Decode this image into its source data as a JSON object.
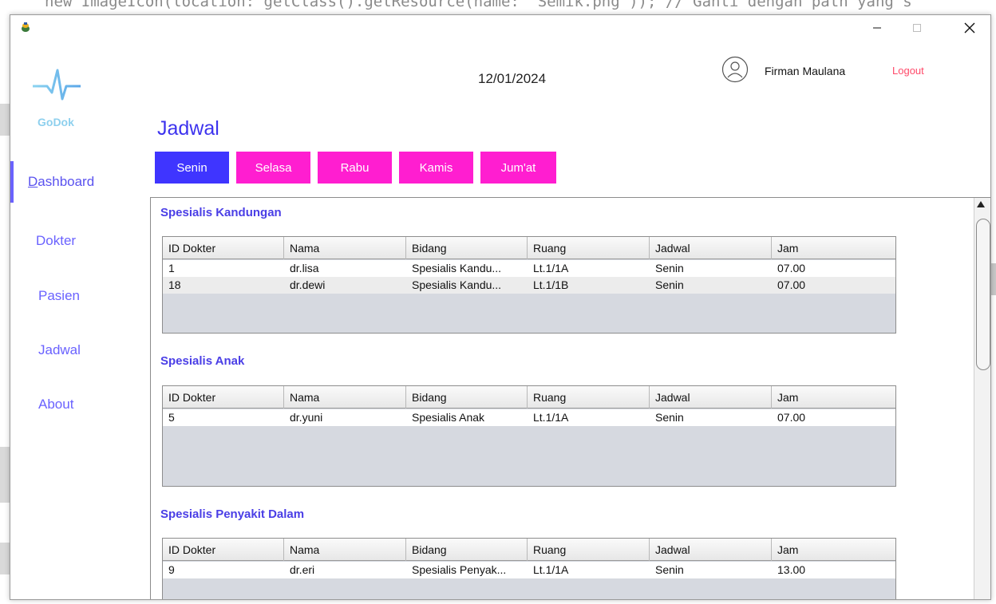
{
  "background": {
    "code_line": "new ImageIcon(location: getClass().getResource(name: \"Semik.png\")); // Ganti dengan path yang s"
  },
  "window": {
    "controls": {
      "minimize": "—",
      "maximize": "☐",
      "close": "✕"
    }
  },
  "sidebar": {
    "logo_text": "GoDok",
    "items": [
      {
        "label": "Dashboard",
        "active": true,
        "mnemonic": "D"
      },
      {
        "label": "Dokter",
        "active": false
      },
      {
        "label": "Pasien",
        "active": false
      },
      {
        "label": "Jadwal",
        "active": false
      },
      {
        "label": "About",
        "active": false
      }
    ]
  },
  "header": {
    "date": "12/01/2024",
    "user_name": "Firman Maulana",
    "logout_label": "Logout"
  },
  "main": {
    "title": "Jadwal",
    "day_tabs": [
      {
        "label": "Senin",
        "color": "#3f35ff"
      },
      {
        "label": "Selasa",
        "color": "#ff1ed0"
      },
      {
        "label": "Rabu",
        "color": "#ff1ed0"
      },
      {
        "label": "Kamis",
        "color": "#ff1ed0"
      },
      {
        "label": "Jum'at",
        "color": "#ff1ed0"
      }
    ],
    "columns": [
      "ID Dokter",
      "Nama",
      "Bidang",
      "Ruang",
      "Jadwal",
      "Jam"
    ],
    "sections": [
      {
        "title": "Spesialis Kandungan",
        "rows": [
          [
            "1",
            "dr.lisa",
            "Spesialis Kandu...",
            "Lt.1/1A",
            "Senin",
            "07.00"
          ],
          [
            "18",
            "dr.dewi",
            "Spesialis Kandu...",
            "Lt.1/1B",
            "Senin",
            "07.00"
          ]
        ]
      },
      {
        "title": "Spesialis Anak",
        "rows": [
          [
            "5",
            "dr.yuni",
            "Spesialis Anak",
            "Lt.1/1A",
            "Senin",
            "07.00"
          ]
        ]
      },
      {
        "title": "Spesialis Penyakit Dalam",
        "rows": [
          [
            "9",
            "dr.eri",
            "Spesialis Penyak...",
            "Lt.1/1A",
            "Senin",
            "13.00"
          ]
        ]
      }
    ]
  },
  "colors": {
    "accent": "#3d33ee",
    "tab_active": "#3f35ff",
    "tab_inactive": "#ff1ed0",
    "logout": "#ff4a6a",
    "logo": "#8ed0ee"
  },
  "icons": {
    "app": "java-cup-icon",
    "avatar": "user-avatar-icon",
    "logo": "heartbeat-icon"
  }
}
